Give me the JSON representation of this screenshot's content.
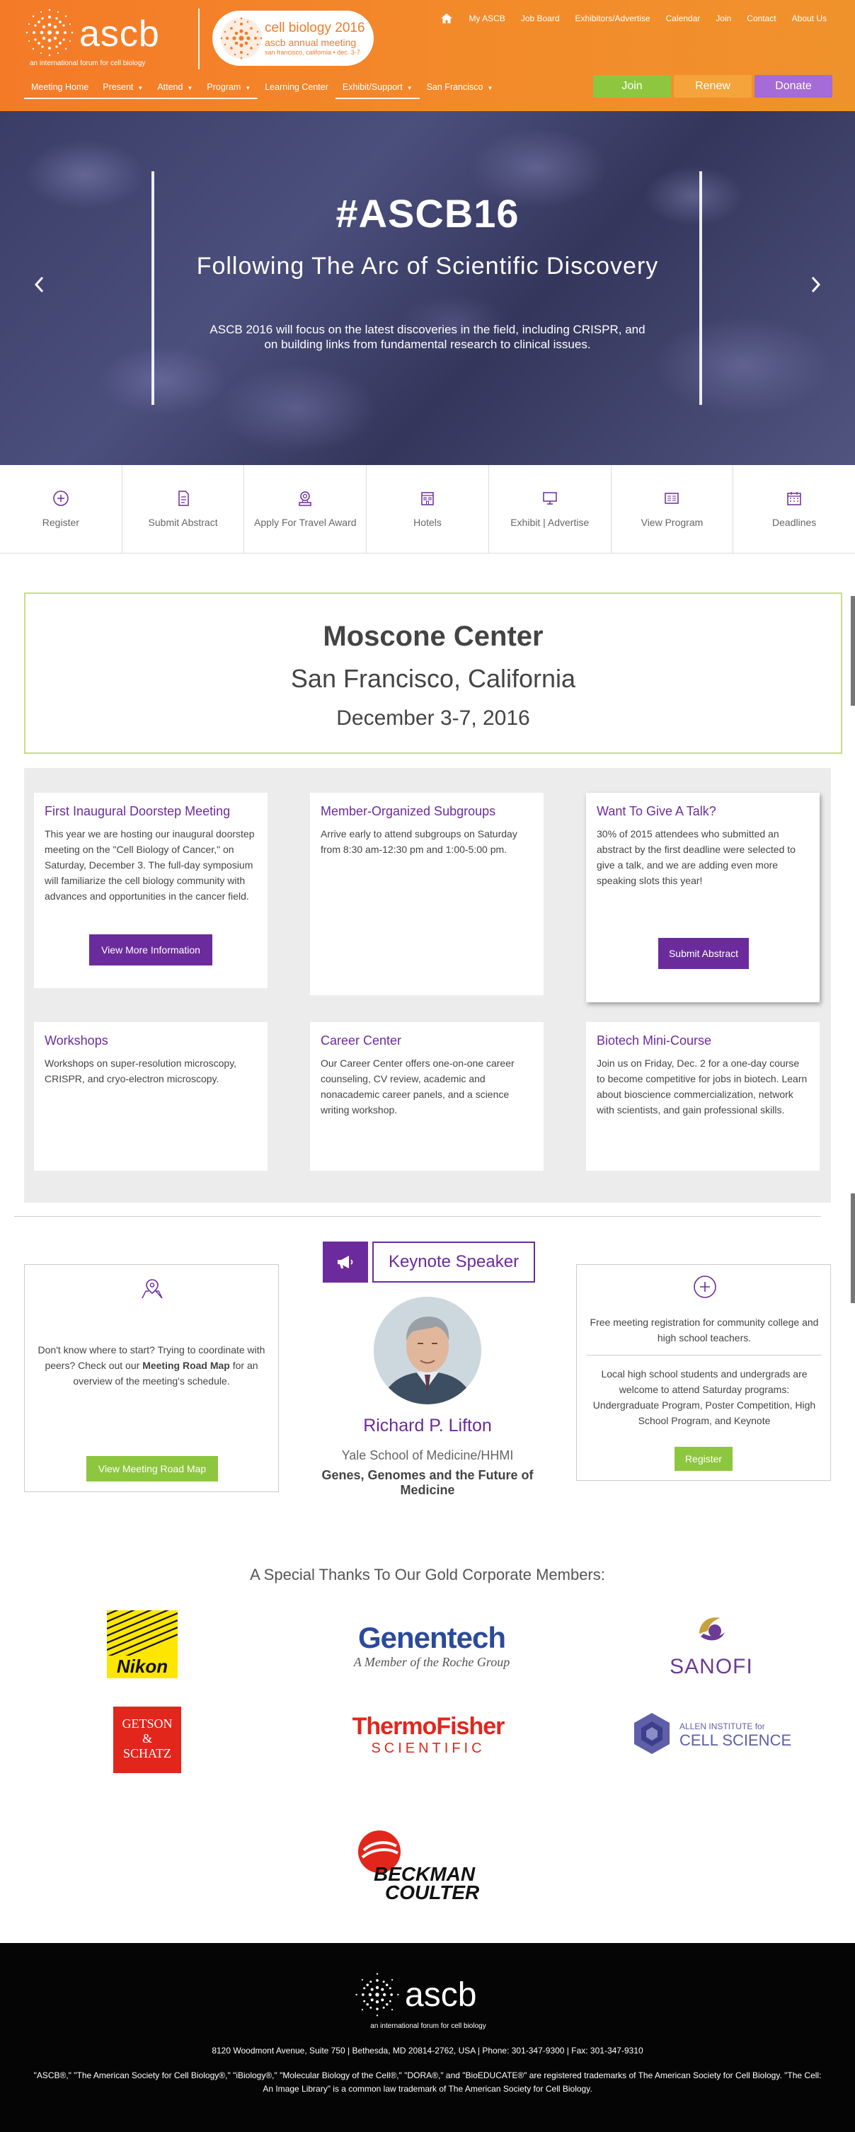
{
  "brand": {
    "logo_word": "ascb",
    "logo_tagline": "an international forum for cell biology",
    "meeting_title": "cell biology 2016",
    "meeting_sub": "ascb annual meeting",
    "meeting_loc": "san francisco, california • dec. 3-7",
    "colors": {
      "orange": "#f47a28",
      "purple": "#6b2b9c",
      "green": "#8dc63f",
      "lavender": "#a56bd6"
    }
  },
  "top_links": [
    "My ASCB",
    "Job Board",
    "Exhibitors/Advertise",
    "Calendar",
    "Join",
    "Contact",
    "About Us"
  ],
  "nav": [
    {
      "label": "Meeting Home",
      "caret": false
    },
    {
      "label": "Present",
      "caret": true
    },
    {
      "label": "Attend",
      "caret": true
    },
    {
      "label": "Program",
      "caret": true
    },
    {
      "label": "Learning Center",
      "caret": false
    },
    {
      "label": "Exhibit/Support",
      "caret": true
    },
    {
      "label": "San Francisco",
      "caret": true
    }
  ],
  "header_buttons": {
    "join": "Join",
    "renew": "Renew",
    "donate": "Donate"
  },
  "hero": {
    "title": "#ASCB16",
    "subtitle": "Following The Arc of Scientific Discovery",
    "description": "ASCB 2016 will focus on the latest discoveries in the field, including CRISPR, and on building links from fundamental research to clinical issues."
  },
  "quick_links": [
    {
      "label": "Register",
      "icon": "plus-circle-icon"
    },
    {
      "label": "Submit Abstract",
      "icon": "document-icon"
    },
    {
      "label": "Apply For Travel Award",
      "icon": "award-icon"
    },
    {
      "label": "Hotels",
      "icon": "hotel-icon"
    },
    {
      "label": "Exhibit | Advertise",
      "icon": "monitor-icon"
    },
    {
      "label": "View Program",
      "icon": "program-icon"
    },
    {
      "label": "Deadlines",
      "icon": "calendar-icon"
    }
  ],
  "venue": {
    "name": "Moscone Center",
    "city": "San Francisco, California",
    "dates": "December 3-7, 2016"
  },
  "cards": {
    "doorstep": {
      "title": "First Inaugural Doorstep Meeting",
      "text": "This year we are hosting our inaugural doorstep meeting on the \"Cell Biology of Cancer,\" on Saturday, December 3. The full-day symposium will familiarize the cell biology community with advances and opportunities in the cancer field.",
      "button": "View More Information"
    },
    "subgroups": {
      "title": "Member-Organized Subgroups",
      "text": "Arrive early to attend subgroups on Saturday from 8:30 am-12:30 pm and 1:00-5:00 pm."
    },
    "talk": {
      "title": "Want To Give A Talk?",
      "text": "30% of 2015 attendees who submitted an abstract by the first deadline were selected to give a talk, and we are adding even more speaking slots this year!",
      "button": "Submit Abstract"
    },
    "workshops": {
      "title": "Workshops",
      "text": "Workshops on super-resolution microscopy, CRISPR, and cryo-electron microscopy."
    },
    "career": {
      "title": "Career Center",
      "text": "Our Career Center offers one-on-one career counseling, CV review, academic and nonacademic career panels, and a science writing workshop."
    },
    "biotech": {
      "title": "Biotech Mini-Course",
      "text": "Join us on Friday, Dec. 2 for a one-day course to become competitive for jobs in biotech. Learn about bioscience commercialization, network with scientists, and gain professional skills."
    }
  },
  "roadmap": {
    "text_before": "Don't know where to start? Trying to coordinate with peers? Check out our ",
    "text_bold": "Meeting Road Map",
    "text_after": " for an overview of the meeting's schedule.",
    "button": "View Meeting Road Map"
  },
  "keynote": {
    "label": "Keynote Speaker",
    "name": "Richard P. Lifton",
    "affiliation": "Yale School of Medicine/HHMI",
    "talk": "Genes, Genomes and the Future of Medicine"
  },
  "community": {
    "text1": "Free meeting registration for community college and high school teachers.",
    "text2": "Local high school students and undergrads are welcome to attend Saturday programs: Undergraduate Program, Poster Competition, High School Program, and Keynote",
    "button": "Register"
  },
  "sponsors": {
    "title": "A Special Thanks To Our Gold Corporate Members:",
    "nikon": "Nikon",
    "genentech": "Genentech",
    "genentech_sub": "A Member of the Roche Group",
    "sanofi": "SANOFI",
    "getson_1": "GETSON",
    "getson_2": "&",
    "getson_3": "SCHATZ",
    "thermo_1": "ThermoFisher",
    "thermo_2": "SCIENTIFIC",
    "allen_1": "ALLEN INSTITUTE for",
    "allen_2": "CELL SCIENCE",
    "beckman_1": "BECKMAN",
    "beckman_2": "COULTER"
  },
  "footer": {
    "logo_word": "ascb",
    "tagline": "an international forum for cell biology",
    "address": "8120 Woodmont Avenue, Suite 750 | Bethesda, MD 20814-2762, USA | Phone: 301-347-9300 | Fax: 301-347-9310",
    "legal": "\"ASCB®,\" \"The American Society for Cell Biology®,\" \"iBiology®,\" \"Molecular Biology of the Cell®,\" \"DORA®,\" and \"BioEDUCATE®\" are registered trademarks of The American Society for Cell Biology. \"The Cell: An Image Library\" is a common law trademark of The American Society for Cell Biology."
  }
}
